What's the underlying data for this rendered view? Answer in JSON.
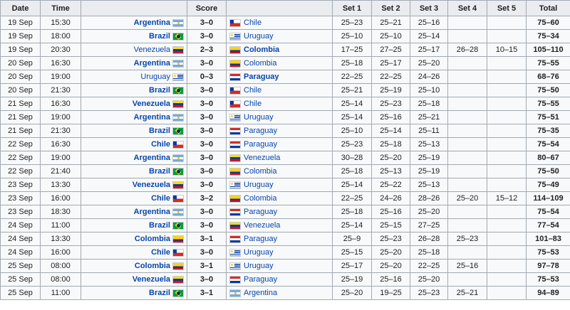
{
  "headers": {
    "date": "Date",
    "time": "Time",
    "home": "",
    "score": "Score",
    "away": "",
    "set1": "Set 1",
    "set2": "Set 2",
    "set3": "Set 3",
    "set4": "Set 4",
    "set5": "Set 5",
    "total": "Total"
  },
  "matches": [
    {
      "date": "19 Sep",
      "time": "15:30",
      "home": "Argentina",
      "home_flag": "ARG",
      "score": "3–0",
      "away": "Chile",
      "away_flag": "CHI",
      "winner": "home",
      "sets": [
        "25–23",
        "25–21",
        "25–16",
        "",
        ""
      ],
      "total": "75–60"
    },
    {
      "date": "19 Sep",
      "time": "18:00",
      "home": "Brazil",
      "home_flag": "BRA",
      "score": "3–0",
      "away": "Uruguay",
      "away_flag": "URU",
      "winner": "home",
      "sets": [
        "25–10",
        "25–10",
        "25–14",
        "",
        ""
      ],
      "total": "75–34"
    },
    {
      "date": "19 Sep",
      "time": "20:30",
      "home": "Venezuela",
      "home_flag": "VEN",
      "score": "2–3",
      "away": "Colombia",
      "away_flag": "COL",
      "winner": "away",
      "sets": [
        "17–25",
        "27–25",
        "25–17",
        "26–28",
        "10–15"
      ],
      "total": "105–110"
    },
    {
      "date": "20 Sep",
      "time": "16:30",
      "home": "Argentina",
      "home_flag": "ARG",
      "score": "3–0",
      "away": "Colombia",
      "away_flag": "COL",
      "winner": "home",
      "sets": [
        "25–18",
        "25–17",
        "25–20",
        "",
        ""
      ],
      "total": "75–55"
    },
    {
      "date": "20 Sep",
      "time": "19:00",
      "home": "Uruguay",
      "home_flag": "URU",
      "score": "0–3",
      "away": "Paraguay",
      "away_flag": "PAR",
      "winner": "away",
      "sets": [
        "22–25",
        "22–25",
        "24–26",
        "",
        ""
      ],
      "total": "68–76"
    },
    {
      "date": "20 Sep",
      "time": "21:30",
      "home": "Brazil",
      "home_flag": "BRA",
      "score": "3–0",
      "away": "Chile",
      "away_flag": "CHI",
      "winner": "home",
      "sets": [
        "25–21",
        "25–19",
        "25–10",
        "",
        ""
      ],
      "total": "75–50"
    },
    {
      "date": "21 Sep",
      "time": "16:30",
      "home": "Venezuela",
      "home_flag": "VEN",
      "score": "3–0",
      "away": "Chile",
      "away_flag": "CHI",
      "winner": "home",
      "sets": [
        "25–14",
        "25–23",
        "25–18",
        "",
        ""
      ],
      "total": "75–55"
    },
    {
      "date": "21 Sep",
      "time": "19:00",
      "home": "Argentina",
      "home_flag": "ARG",
      "score": "3–0",
      "away": "Uruguay",
      "away_flag": "URU",
      "winner": "home",
      "sets": [
        "25–14",
        "25–16",
        "25–21",
        "",
        ""
      ],
      "total": "75–51"
    },
    {
      "date": "21 Sep",
      "time": "21:30",
      "home": "Brazil",
      "home_flag": "BRA",
      "score": "3–0",
      "away": "Paraguay",
      "away_flag": "PAR",
      "winner": "home",
      "sets": [
        "25–10",
        "25–14",
        "25–11",
        "",
        ""
      ],
      "total": "75–35"
    },
    {
      "date": "22 Sep",
      "time": "16:30",
      "home": "Chile",
      "home_flag": "CHI",
      "score": "3–0",
      "away": "Paraguay",
      "away_flag": "PAR",
      "winner": "home",
      "sets": [
        "25–23",
        "25–18",
        "25–13",
        "",
        ""
      ],
      "total": "75–54"
    },
    {
      "date": "22 Sep",
      "time": "19:00",
      "home": "Argentina",
      "home_flag": "ARG",
      "score": "3–0",
      "away": "Venezuela",
      "away_flag": "VEN",
      "winner": "home",
      "sets": [
        "30–28",
        "25–20",
        "25–19",
        "",
        ""
      ],
      "total": "80–67"
    },
    {
      "date": "22 Sep",
      "time": "21:40",
      "home": "Brazil",
      "home_flag": "BRA",
      "score": "3–0",
      "away": "Colombia",
      "away_flag": "COL",
      "winner": "home",
      "sets": [
        "25–18",
        "25–13",
        "25–19",
        "",
        ""
      ],
      "total": "75–50"
    },
    {
      "date": "23 Sep",
      "time": "13:30",
      "home": "Venezuela",
      "home_flag": "VEN",
      "score": "3–0",
      "away": "Uruguay",
      "away_flag": "URU",
      "winner": "home",
      "sets": [
        "25–14",
        "25–22",
        "25–13",
        "",
        ""
      ],
      "total": "75–49"
    },
    {
      "date": "23 Sep",
      "time": "16:00",
      "home": "Chile",
      "home_flag": "CHI",
      "score": "3–2",
      "away": "Colombia",
      "away_flag": "COL",
      "winner": "home",
      "sets": [
        "22–25",
        "24–26",
        "28–26",
        "25–20",
        "15–12"
      ],
      "total": "114–109"
    },
    {
      "date": "23 Sep",
      "time": "18:30",
      "home": "Argentina",
      "home_flag": "ARG",
      "score": "3–0",
      "away": "Paraguay",
      "away_flag": "PAR",
      "winner": "home",
      "sets": [
        "25–18",
        "25–16",
        "25–20",
        "",
        ""
      ],
      "total": "75–54"
    },
    {
      "date": "24 Sep",
      "time": "11:00",
      "home": "Brazil",
      "home_flag": "BRA",
      "score": "3–0",
      "away": "Venezuela",
      "away_flag": "VEN",
      "winner": "home",
      "sets": [
        "25–14",
        "25–15",
        "27–25",
        "",
        ""
      ],
      "total": "77–54"
    },
    {
      "date": "24 Sep",
      "time": "13:30",
      "home": "Colombia",
      "home_flag": "COL",
      "score": "3–1",
      "away": "Paraguay",
      "away_flag": "PAR",
      "winner": "home",
      "sets": [
        "25–9",
        "25–23",
        "26–28",
        "25–23",
        ""
      ],
      "total": "101–83"
    },
    {
      "date": "24 Sep",
      "time": "16:00",
      "home": "Chile",
      "home_flag": "CHI",
      "score": "3–0",
      "away": "Uruguay",
      "away_flag": "URU",
      "winner": "home",
      "sets": [
        "25–15",
        "25–20",
        "25–18",
        "",
        ""
      ],
      "total": "75–53"
    },
    {
      "date": "25 Sep",
      "time": "08:00",
      "home": "Colombia",
      "home_flag": "COL",
      "score": "3–1",
      "away": "Uruguay",
      "away_flag": "URU",
      "winner": "home",
      "sets": [
        "25–17",
        "25–20",
        "22–25",
        "25–16",
        ""
      ],
      "total": "97–78"
    },
    {
      "date": "25 Sep",
      "time": "08:00",
      "home": "Venezuela",
      "home_flag": "VEN",
      "score": "3–0",
      "away": "Paraguay",
      "away_flag": "PAR",
      "winner": "home",
      "sets": [
        "25–19",
        "25–16",
        "25–20",
        "",
        ""
      ],
      "total": "75–53"
    },
    {
      "date": "25 Sep",
      "time": "11:00",
      "home": "Brazil",
      "home_flag": "BRA",
      "score": "3–1",
      "away": "Argentina",
      "away_flag": "ARG",
      "winner": "home",
      "sets": [
        "25–20",
        "19–25",
        "25–23",
        "25–21",
        ""
      ],
      "total": "94–89"
    }
  ]
}
